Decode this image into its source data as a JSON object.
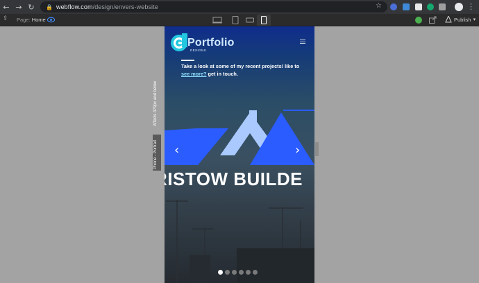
{
  "browser": {
    "url_host": "webflow.com",
    "url_path": "/design/envers-website"
  },
  "designer": {
    "page_label": "Page:",
    "page_name": "Home",
    "publish_label": "Publish",
    "breakpoint_label": "Phone - Portrait",
    "breakpoint_note": "Affects 479px and below"
  },
  "site": {
    "logo_text": "Portfolio",
    "logo_sub": "DESIGNS",
    "intro_text": "Take a look at some of my recent projects! like to",
    "intro_link": "see more?",
    "intro_end": "get in touch.",
    "headline": "RISTOW BUILDE",
    "slider_dots": 6,
    "active_dot": 0
  },
  "colors": {
    "accent_blue": "#2a5cff",
    "light_blue": "#a9c9ff",
    "link": "#8fe0ff"
  }
}
